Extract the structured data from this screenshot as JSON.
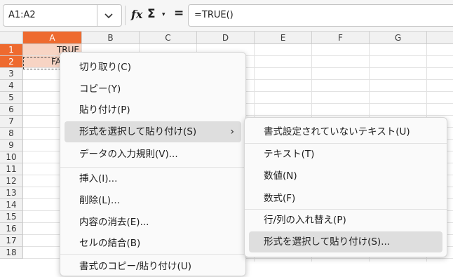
{
  "namebox": {
    "value": "A1:A2"
  },
  "formula_bar": {
    "fx_label": "fx",
    "sigma_label": "Σ",
    "sigma_dropdown": "▾",
    "equal_label": "=",
    "formula": "=TRUE()"
  },
  "columns": [
    "A",
    "B",
    "C",
    "D",
    "E",
    "F",
    "G"
  ],
  "rows": [
    "1",
    "2",
    "3",
    "4",
    "5",
    "6",
    "7",
    "8",
    "9",
    "10",
    "11",
    "12",
    "13",
    "14",
    "15",
    "16",
    "17",
    "18"
  ],
  "cells": {
    "A1": "TRUE",
    "A2": "FA"
  },
  "context_menu": {
    "items": [
      "切り取り(C)",
      "コピー(Y)",
      "貼り付け(P)",
      "形式を選択して貼り付け(S)",
      "データの入力規則(V)...",
      "挿入(I)...",
      "削除(L)...",
      "内容の消去(E)...",
      "セルの結合(B)",
      "書式のコピー/貼り付け(U)"
    ],
    "submenu_arrow": "›"
  },
  "submenu": {
    "items": [
      "書式設定されていないテキスト(U)",
      "テキスト(T)",
      "数値(N)",
      "数式(F)",
      "行/列の入れ替え(P)",
      "形式を選択して貼り付け(S)..."
    ]
  },
  "colors": {
    "selection_header": "#ee6a2f",
    "selection_fill": "#f7d4c4"
  }
}
